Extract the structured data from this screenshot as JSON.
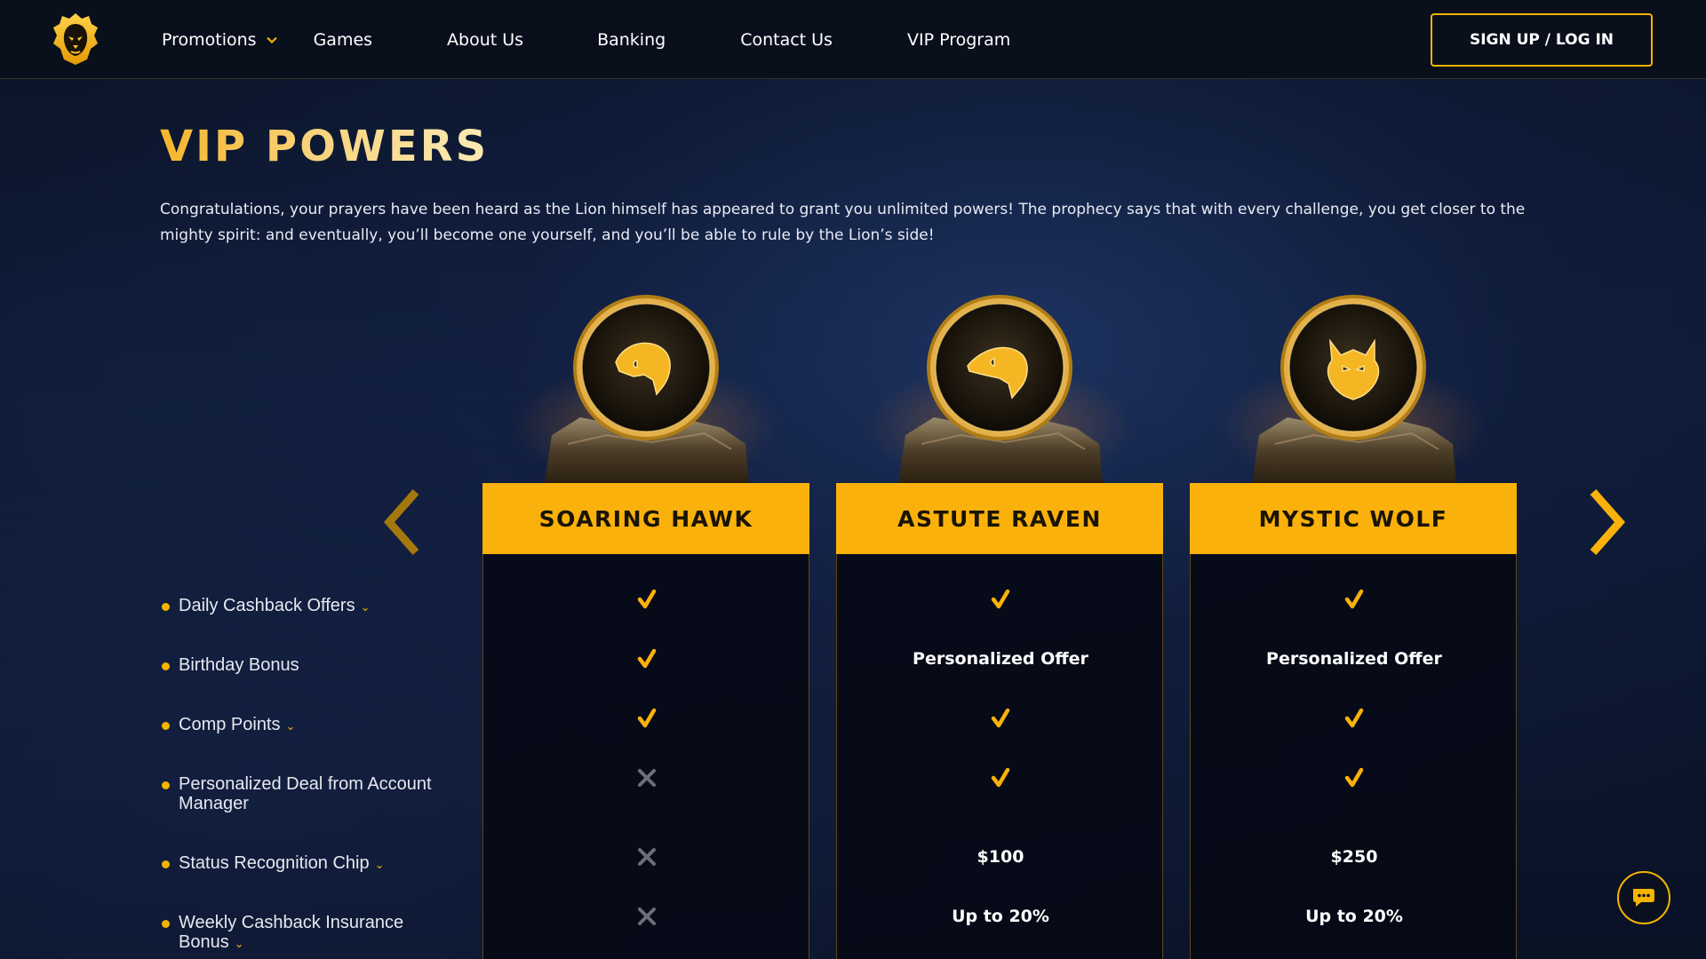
{
  "header": {
    "nav": [
      {
        "label": "Promotions",
        "has_dropdown": true
      },
      {
        "label": "Games"
      },
      {
        "label": "About Us"
      },
      {
        "label": "Banking"
      },
      {
        "label": "Contact Us"
      },
      {
        "label": "VIP Program"
      }
    ],
    "signup_label": "SIGN UP / LOG IN"
  },
  "main": {
    "title": "VIP POWERS",
    "intro": "Congratulations, your prayers have been heard as the Lion himself has appeared to grant you unlimited powers! The prophecy says that with every challenge, you get closer to the mighty spirit: and eventually, you’ll become one yourself, and you’ll be able to rule by the Lion’s side!"
  },
  "features": [
    {
      "line1": "Daily Cashback Offers",
      "line2": "",
      "caret": true
    },
    {
      "line1": "Birthday Bonus",
      "line2": "",
      "caret": false
    },
    {
      "line1": "Comp Points",
      "line2": "",
      "caret": true
    },
    {
      "line1": "Personalized Deal from Account",
      "line2": "Manager",
      "caret": false
    },
    {
      "line1": "Status Recognition Chip",
      "line2": "",
      "caret": true
    },
    {
      "line1": "Weekly Cashback Insurance",
      "line2": "Bonus",
      "caret": true
    }
  ],
  "tiers": [
    {
      "name": "SOARING HAWK",
      "medal_icon": "hawk-icon",
      "values": [
        "check",
        "check",
        "check",
        "cross",
        "cross",
        "cross"
      ]
    },
    {
      "name": "ASTUTE RAVEN",
      "medal_icon": "raven-icon",
      "values": [
        "check",
        "Personalized Offer",
        "check",
        "check",
        "$100",
        "Up to 20%"
      ]
    },
    {
      "name": "MYSTIC WOLF",
      "medal_icon": "wolf-icon",
      "values": [
        "check",
        "Personalized Offer",
        "check",
        "check",
        "$250",
        "Up to 20%"
      ]
    }
  ],
  "colors": {
    "accent": "#fbb10b",
    "cross": "#6b6f78",
    "header_bg": "#0a0f1c"
  }
}
